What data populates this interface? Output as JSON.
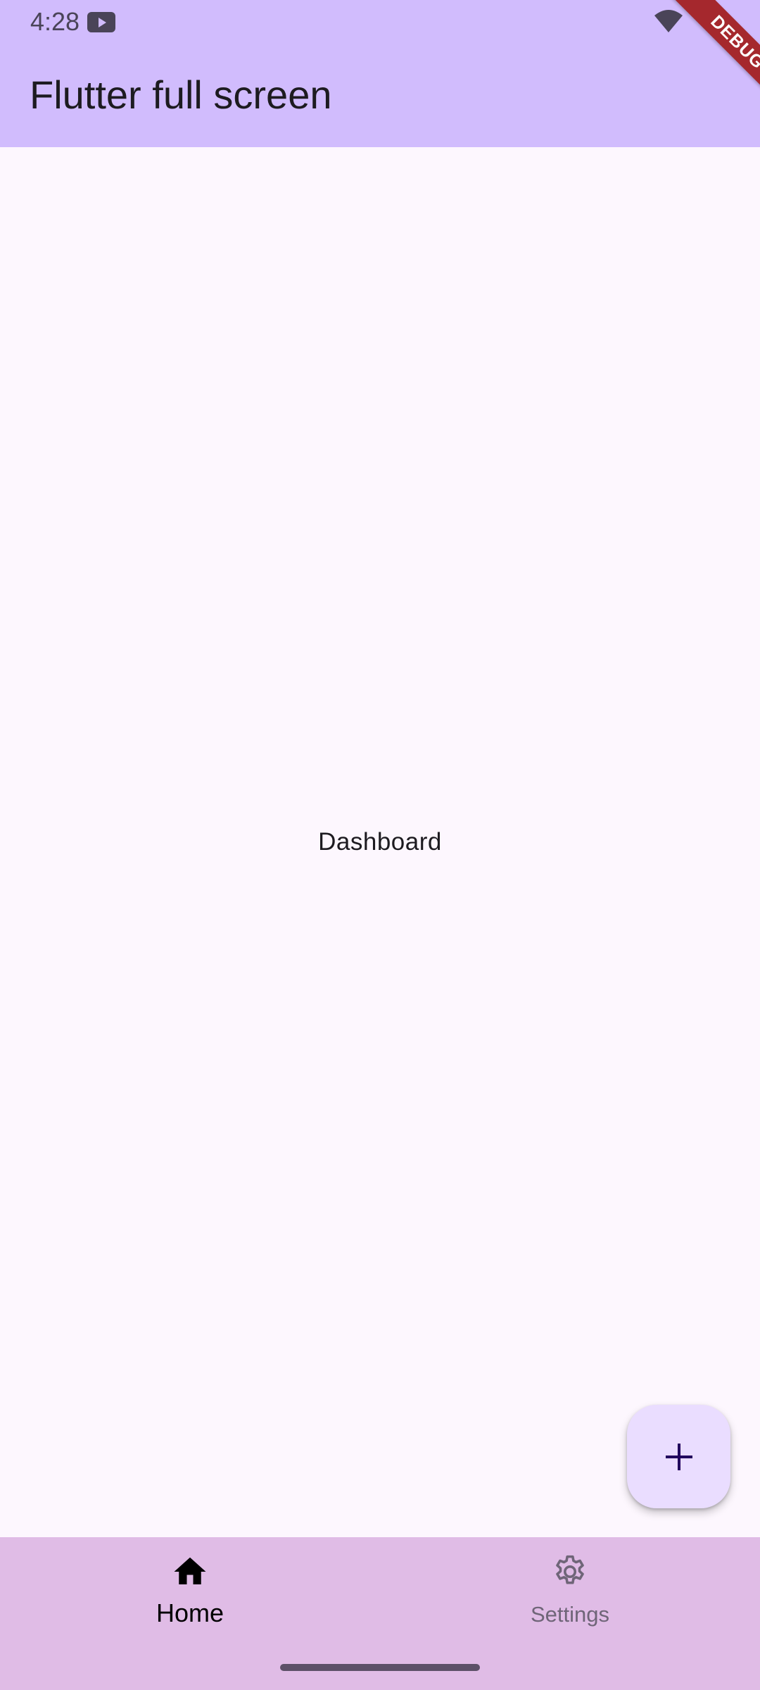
{
  "status_bar": {
    "time": "4:28",
    "app_icon": "play-icon",
    "wifi_icon": "wifi-icon"
  },
  "app_bar": {
    "title": "Flutter full screen",
    "background_color": "#D1BCFD"
  },
  "debug_banner": {
    "label": "DEBUG",
    "color": "#A5282D"
  },
  "main": {
    "center_text": "Dashboard",
    "background_color": "#FDF7FE"
  },
  "fab": {
    "icon": "plus-icon",
    "background_color": "#EADDFF"
  },
  "bottom_nav": {
    "background_color": "#E0BCE6",
    "items": [
      {
        "label": "Home",
        "icon": "home-icon",
        "selected": true
      },
      {
        "label": "Settings",
        "icon": "gear-icon",
        "selected": false
      }
    ]
  }
}
